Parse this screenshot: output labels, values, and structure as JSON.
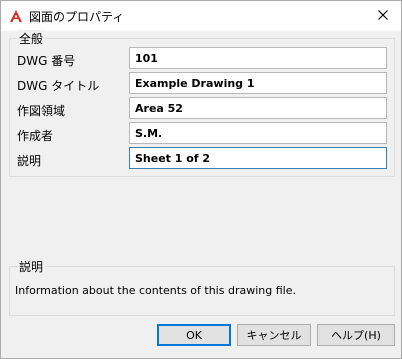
{
  "window": {
    "title": "図面のプロパティ"
  },
  "general": {
    "legend": "全般",
    "fields": [
      {
        "label": "DWG 番号",
        "value": "101"
      },
      {
        "label": "DWG タイトル",
        "value": "Example Drawing 1"
      },
      {
        "label": "作図領域",
        "value": "Area 52"
      },
      {
        "label": "作成者",
        "value": "S.M."
      },
      {
        "label": "説明",
        "value": "Sheet 1 of 2"
      }
    ]
  },
  "description": {
    "legend": "説明",
    "text": "Information about the contents of this drawing file."
  },
  "buttons": {
    "ok": "OK",
    "cancel": "キャンセル",
    "help": "ヘルプ(H)"
  },
  "colors": {
    "accent": "#0078d7",
    "app_icon": "#d0332a"
  },
  "icons": {
    "app": "autocad-icon",
    "close": "close-icon"
  }
}
